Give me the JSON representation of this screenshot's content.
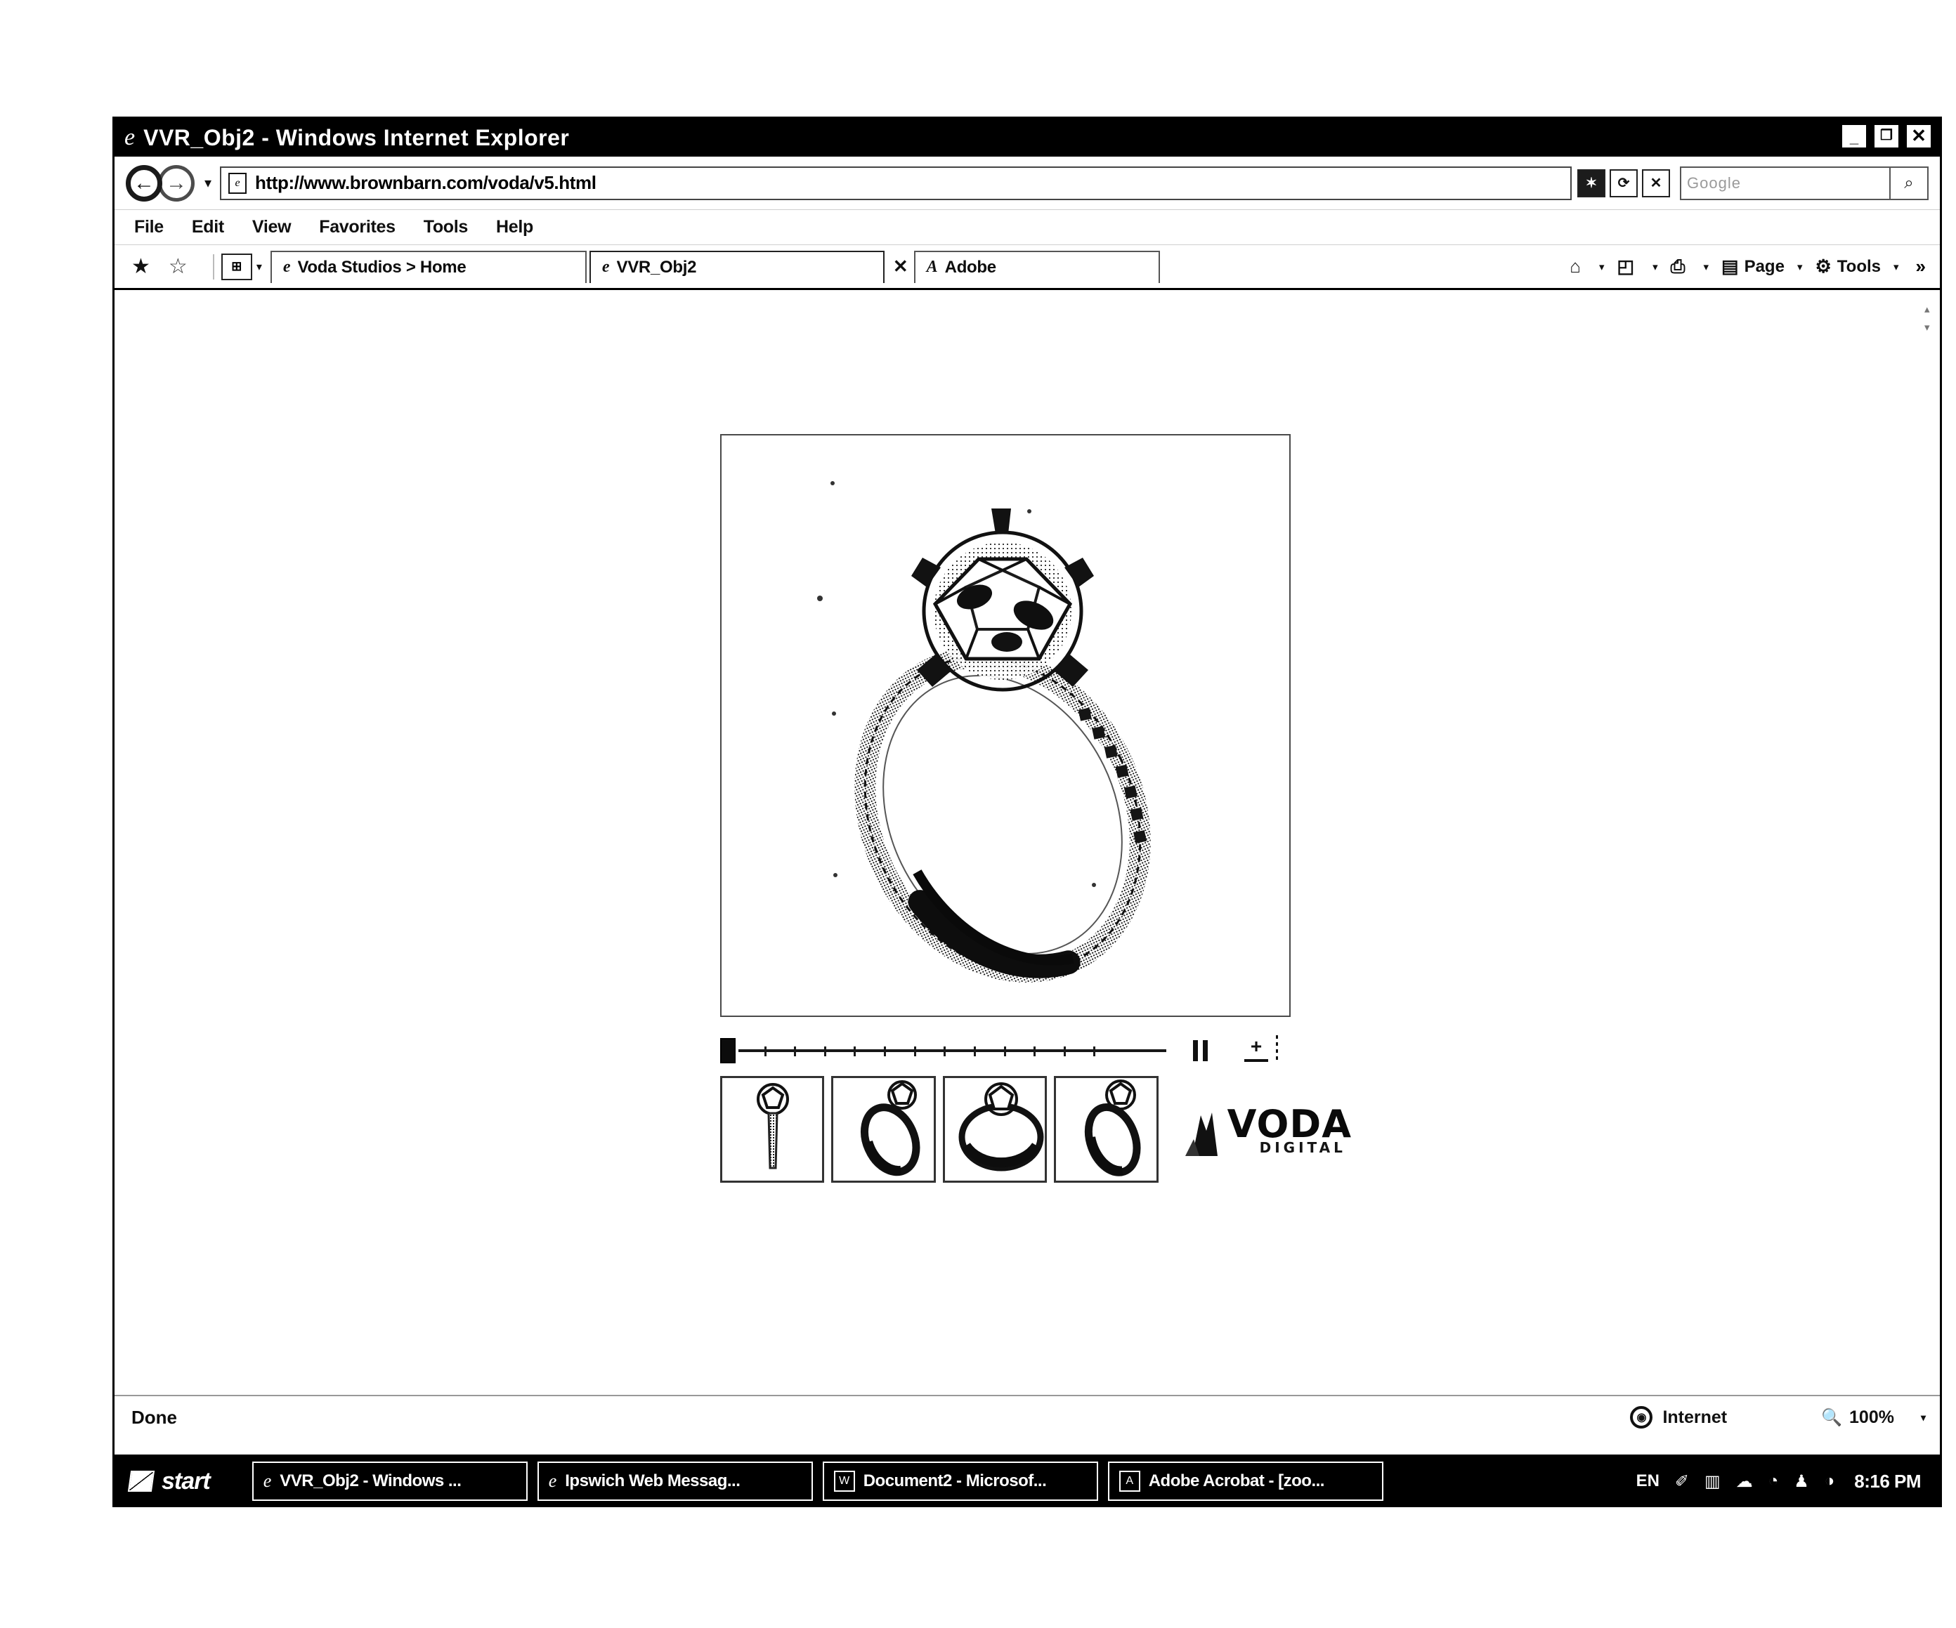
{
  "window": {
    "title": "VVR_Obj2 - Windows Internet Explorer",
    "ie_glyph": "e",
    "minimize_label": "_",
    "restore_label": "❐",
    "close_label": "✕"
  },
  "address_bar": {
    "back_label": "←",
    "forward_label": "→",
    "history_caret": "▾",
    "page_icon": "e",
    "url": "http://www.brownbarn.com/voda/v5.html",
    "refresh_label": "⟳",
    "compat_label": "✶",
    "stop_label": "✕",
    "search_placeholder": "Google",
    "search_go_label": "⌕"
  },
  "menu": {
    "items": [
      "File",
      "Edit",
      "View",
      "Favorites",
      "Tools",
      "Help"
    ]
  },
  "tab_bar": {
    "favorites_add_icon": "★",
    "favorites_center_icon": "☆",
    "quick_tabs_label": "⊞",
    "quick_tabs_caret": "▾",
    "tabs": [
      {
        "favicon": "e",
        "label": "Voda Studios > Home",
        "active": false
      },
      {
        "favicon": "e",
        "label": "VVR_Obj2",
        "active": true,
        "close": "✕"
      },
      {
        "favicon": "A",
        "label": "Adobe",
        "active": false
      }
    ],
    "commands": [
      {
        "icon": "⌂",
        "label": "",
        "caret": "▾",
        "name": "home"
      },
      {
        "icon": "◰",
        "label": "",
        "caret": "▾",
        "name": "feeds"
      },
      {
        "icon": "⎙",
        "label": "",
        "caret": "▾",
        "name": "print"
      },
      {
        "icon": "▤",
        "label": "Page",
        "caret": "▾",
        "name": "page"
      },
      {
        "icon": "⚙",
        "label": "Tools",
        "caret": "▾",
        "name": "tools"
      }
    ],
    "overflow_label": "»"
  },
  "viewer": {
    "product": "Diamond solitaire engagement ring with pave band",
    "slider_position_percent": 0,
    "slider_tick_count": 12,
    "pause_label": "‖",
    "zoom_label": "+",
    "thumbnails": [
      {
        "label": "view-front-upright"
      },
      {
        "label": "view-angled-left"
      },
      {
        "label": "view-top-down"
      },
      {
        "label": "view-angled-right"
      }
    ],
    "logo_word": "VODA",
    "logo_sub": "DIGITAL"
  },
  "status_bar": {
    "status": "Done",
    "zone": "Internet",
    "zone_icon": "⊕",
    "zoom": "100%",
    "zoom_icon": "🔍",
    "zoom_caret": "▾"
  },
  "taskbar": {
    "start_label": "start",
    "items": [
      {
        "icon": "e",
        "icon_kind": "ie",
        "label": "VVR_Obj2 - Windows ..."
      },
      {
        "icon": "e",
        "icon_kind": "ie",
        "label": "Ipswich Web Messag..."
      },
      {
        "icon": "W",
        "icon_kind": "box",
        "label": "Document2 - Microsof..."
      },
      {
        "icon": "A",
        "icon_kind": "box",
        "label": "Adobe Acrobat - [zoo..."
      }
    ],
    "tray": {
      "language": "EN",
      "icons": [
        "✐",
        "▥",
        "☁",
        "◔",
        "♟",
        "◑"
      ],
      "clock": "8:16 PM"
    }
  },
  "scrollbar": {
    "up_arrow": "▴",
    "down_arrow": "▾"
  }
}
